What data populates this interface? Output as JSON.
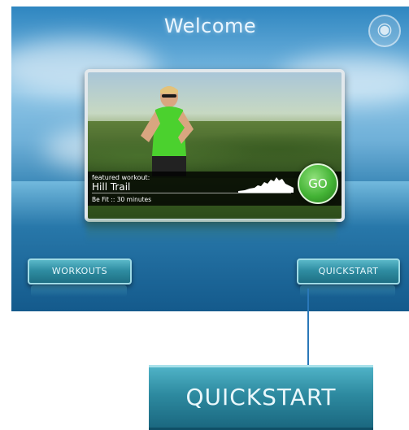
{
  "screen": {
    "title": "Welcome"
  },
  "featured": {
    "label": "featured workout:",
    "name": "Hill Trail",
    "duration": "Be Fit :: 30 minutes",
    "go_label": "GO"
  },
  "buttons": {
    "workouts": "WORKOUTS",
    "quickstart": "QUICKSTART"
  },
  "callout": {
    "label": "QUICKSTART"
  },
  "colors": {
    "go_green": "#43b335",
    "button_teal": "#2f8da2",
    "callout_line": "#2a78b8"
  },
  "icons": [
    "globe-logo-icon",
    "elevation-profile-icon"
  ]
}
